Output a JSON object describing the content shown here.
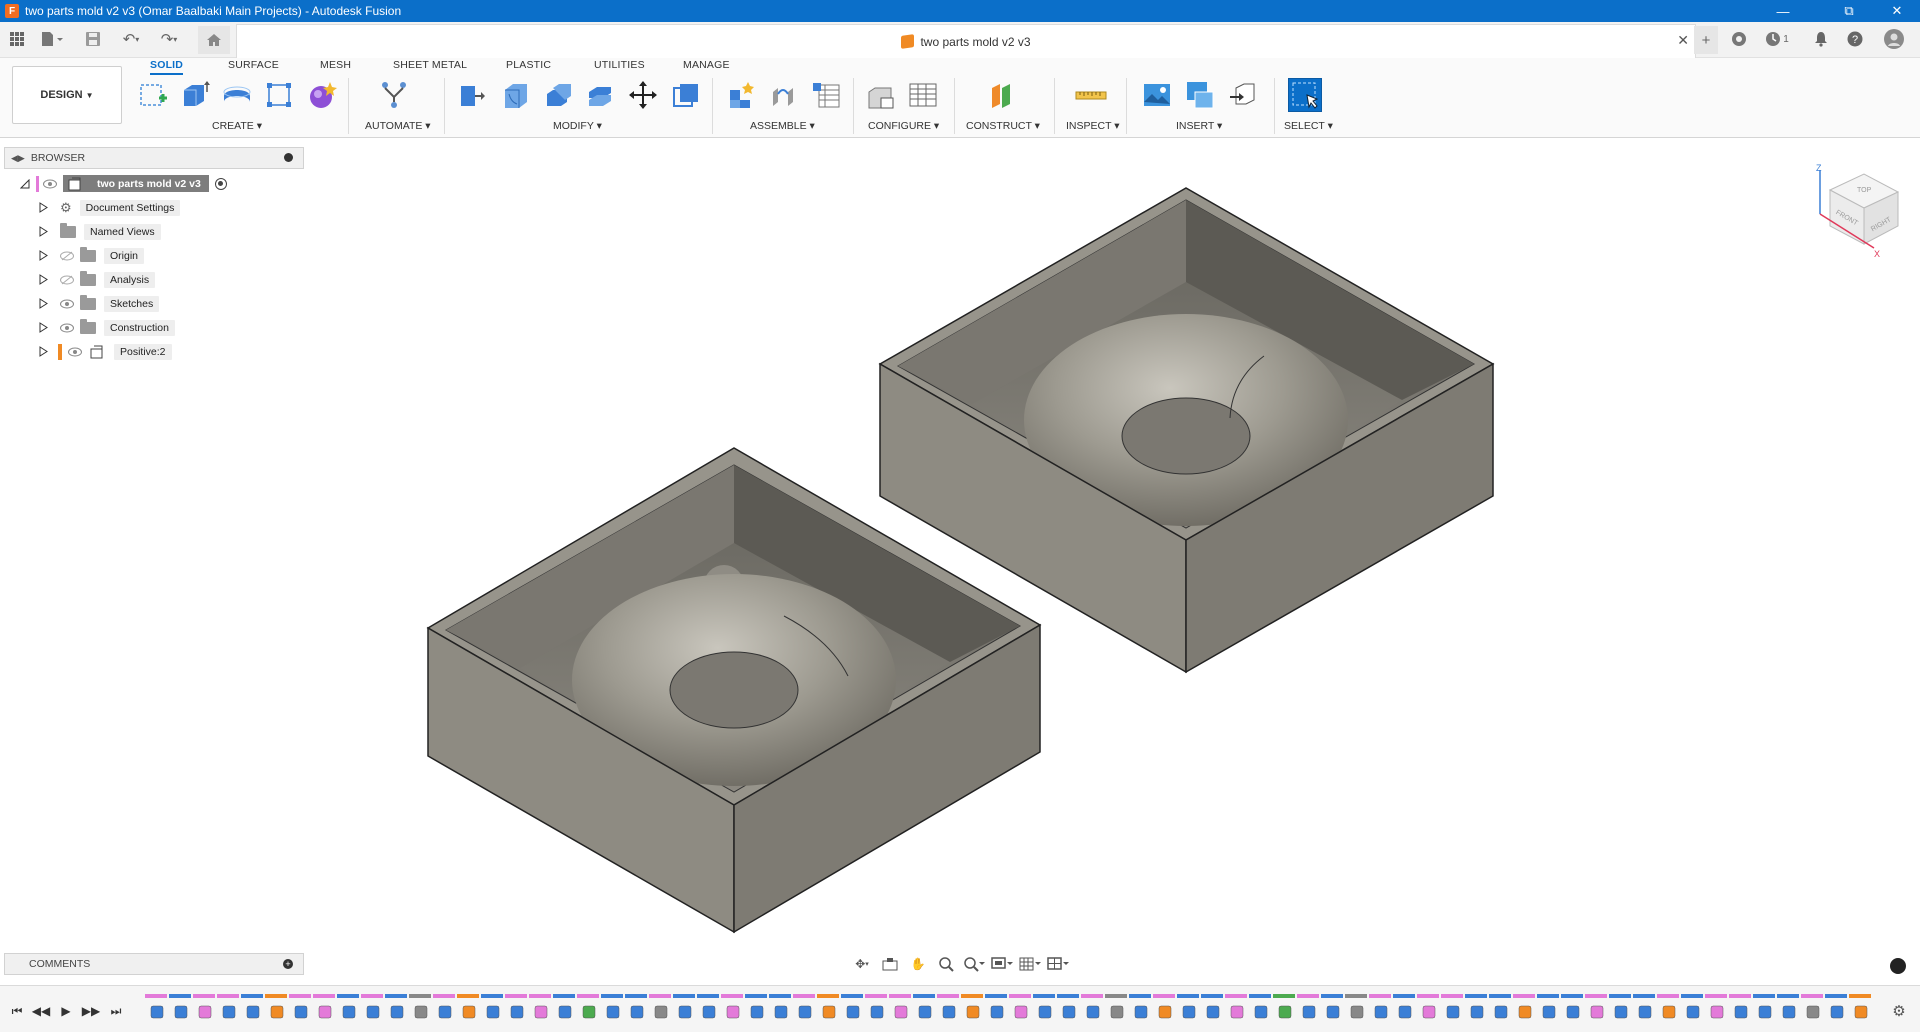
{
  "window": {
    "title": "two parts mold v2 v3 (Omar Baalbaki Main Projects) - Autodesk Fusion"
  },
  "document_tab": {
    "name": "two parts mold v2 v3",
    "job_count": "1"
  },
  "ribbon": {
    "workspace": "DESIGN",
    "tabs": [
      "SOLID",
      "SURFACE",
      "MESH",
      "SHEET METAL",
      "PLASTIC",
      "UTILITIES",
      "MANAGE"
    ],
    "active_tab": "SOLID",
    "groups": {
      "create": "CREATE",
      "automate": "AUTOMATE",
      "modify": "MODIFY",
      "assemble": "ASSEMBLE",
      "configure": "CONFIGURE",
      "construct": "CONSTRUCT",
      "inspect": "INSPECT",
      "insert": "INSERT",
      "select": "SELECT"
    }
  },
  "browser": {
    "title": "BROWSER",
    "root": "two parts mold v2 v3",
    "items": [
      "Document Settings",
      "Named Views",
      "Origin",
      "Analysis",
      "Sketches",
      "Construction",
      "Positive:2"
    ]
  },
  "comments": {
    "title": "COMMENTS"
  },
  "viewcube": {
    "top": "TOP",
    "front": "FRONT",
    "right": "RIGHT",
    "x": "X",
    "z": "Z"
  },
  "colors": {
    "accent": "#0b6fc9",
    "titlebar": "#0b6fc9",
    "model": "#8e8b82",
    "sketch": "#e37ad9",
    "body": "#3b7fd6"
  }
}
